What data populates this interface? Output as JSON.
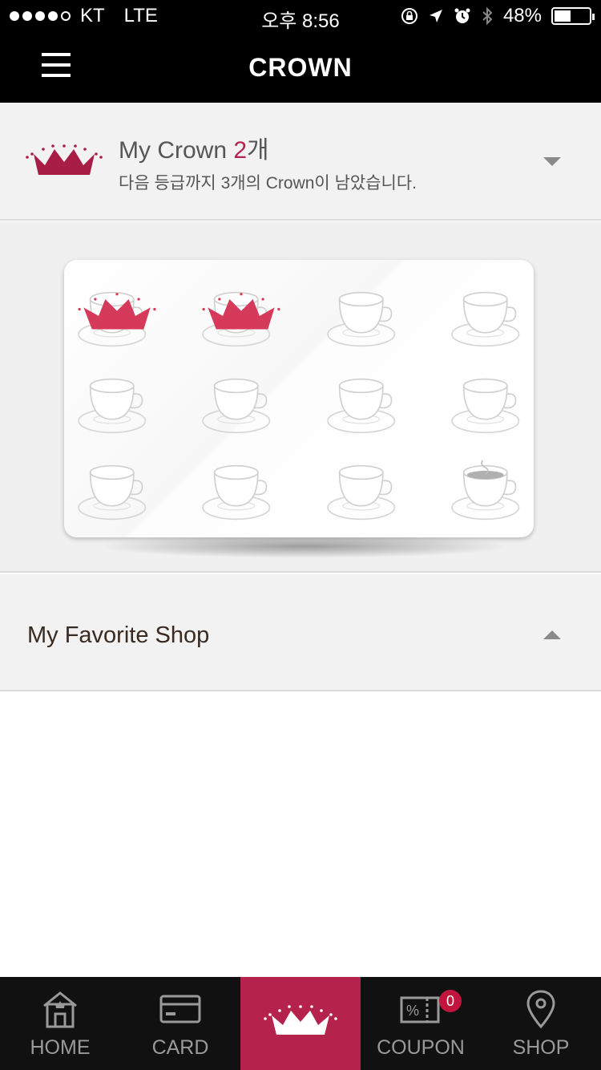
{
  "status_bar": {
    "carrier": "KT",
    "network": "LTE",
    "time": "오후 8:56",
    "battery": "48%",
    "battery_level": 0.48,
    "signal_bars": 4
  },
  "nav": {
    "title": "CROWN"
  },
  "crown_summary": {
    "title_prefix": "My Crown ",
    "count": "2",
    "count_suffix": "개",
    "subtitle": "다음 등급까지 3개의 Crown이 남았습니다."
  },
  "stamp_card": {
    "total": 12,
    "earned": 2
  },
  "favorite_shop": {
    "title": "My Favorite Shop"
  },
  "tabs": [
    {
      "label": "HOME",
      "icon": "home-icon"
    },
    {
      "label": "CARD",
      "icon": "card-icon"
    },
    {
      "label": "",
      "icon": "crown-icon",
      "active": true
    },
    {
      "label": "COUPON",
      "icon": "coupon-icon",
      "badge": "0"
    },
    {
      "label": "SHOP",
      "icon": "location-pin-icon"
    }
  ],
  "colors": {
    "accent": "#b5234d",
    "crown": "#d63a5a",
    "bar_bg": "#000000",
    "panel_bg": "#f2f2f2"
  }
}
